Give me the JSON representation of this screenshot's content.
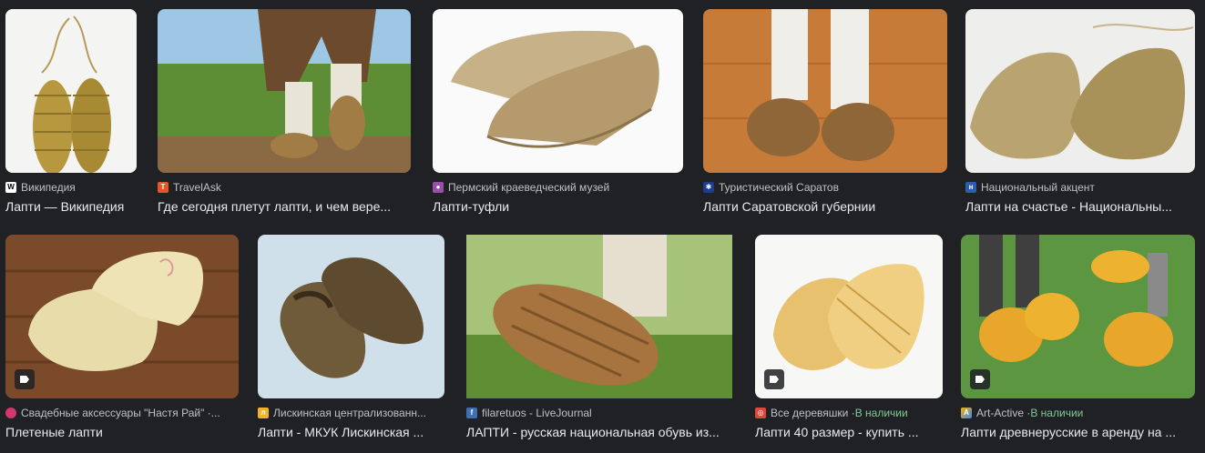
{
  "results_row1": [
    {
      "source": "Википедия",
      "title": "Лапти — Википедия",
      "favicon": "wikipedia-icon",
      "in_stock": ""
    },
    {
      "source": "TravelAsk",
      "title": "Где сегодня плетут лапти, и чем вере...",
      "favicon": "travelask-icon",
      "in_stock": ""
    },
    {
      "source": "Пермский краеведческий музей",
      "title": "Лапти-туфли",
      "favicon": "museum-icon",
      "in_stock": ""
    },
    {
      "source": "Туристический Саратов",
      "title": "Лапти Саратовской губернии",
      "favicon": "saratov-icon",
      "in_stock": ""
    },
    {
      "source": "Национальный акцент",
      "title": "Лапти на счастье - Национальны...",
      "favicon": "accent-icon",
      "in_stock": ""
    }
  ],
  "results_row2": [
    {
      "source": "Свадебные аксессуары \"Настя Рай\" ·...",
      "title": "Плетеные лапти",
      "favicon": "wedding-icon",
      "in_stock": ""
    },
    {
      "source": "Лискинская централизованн...",
      "title": "Лапти - МКУК Лискинская ...",
      "favicon": "library-icon",
      "in_stock": ""
    },
    {
      "source": "filaretuos - LiveJournal",
      "title": "ЛАПТИ - русская национальная обувь из...",
      "favicon": "livejournal-icon",
      "in_stock": ""
    },
    {
      "source": "Все деревяшки · ",
      "title": "Лапти 40 размер - купить ...",
      "favicon": "wood-icon",
      "in_stock": "В наличии"
    },
    {
      "source": "Art-Active · ",
      "title": "Лапти древнерусские в аренду на ...",
      "favicon": "artactive-icon",
      "in_stock": "В наличии"
    }
  ],
  "colors": {
    "background": "#202124",
    "text": "#e8eaed",
    "meta": "#bdc1c6",
    "in_stock": "#81c995"
  }
}
